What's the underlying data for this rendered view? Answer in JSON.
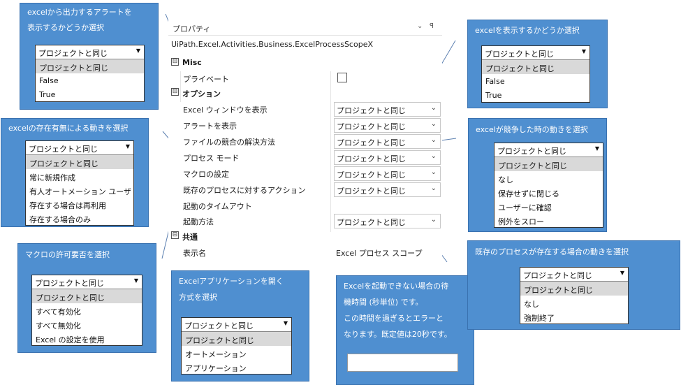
{
  "panel": {
    "title": "プロパティ",
    "controls": [
      "⌄",
      "ꟼ"
    ],
    "type_name": "UiPath.Excel.Activities.Business.ExcelProcessScopeX",
    "sections": {
      "misc": {
        "toggle": "⊟",
        "label": "Misc"
      },
      "options": {
        "toggle": "⊟",
        "label": "オプション"
      },
      "common": {
        "toggle": "⊟",
        "label": "共通"
      }
    },
    "rows": {
      "private": {
        "name": "プライベート"
      },
      "show_window": {
        "name": "Excel ウィンドウを表示",
        "value": "プロジェクトと同じ"
      },
      "show_alerts": {
        "name": "アラートを表示",
        "value": "プロジェクトと同じ"
      },
      "conflict": {
        "name": "ファイルの競合の解決方法",
        "value": "プロジェクトと同じ"
      },
      "process_mode": {
        "name": "プロセス モード",
        "value": "プロジェクトと同じ"
      },
      "macro": {
        "name": "マクロの設定",
        "value": "プロジェクトと同じ"
      },
      "existing": {
        "name": "既存のプロセスに対するアクション",
        "value": "プロジェクトと同じ"
      },
      "timeout": {
        "name": "起動のタイムアウト",
        "value": ""
      },
      "launch": {
        "name": "起動方法",
        "value": "プロジェクトと同じ"
      },
      "display_name": {
        "name": "表示名",
        "value": "Excel プロセス スコープ"
      }
    },
    "chevron": "⌄"
  },
  "callouts": {
    "alert": {
      "lines": [
        "excelから出力するアラートを",
        "表示するかどうか選択"
      ],
      "selected": "プロジェクトと同じ",
      "options": [
        "プロジェクトと同じ",
        "False",
        "True"
      ]
    },
    "exists": {
      "lines": [
        "excelの存在有無による動きを選択"
      ],
      "selected": "プロジェクトと同じ",
      "options": [
        "プロジェクトと同じ",
        "常に新規作成",
        "有人オートメーション ユーザー",
        "存在する場合は再利用",
        "存在する場合のみ"
      ]
    },
    "macro": {
      "lines": [
        "マクロの許可要否を選択"
      ],
      "selected": "プロジェクトと同じ",
      "options": [
        "プロジェクトと同じ",
        "すべて有効化",
        "すべて無効化",
        "Excel の設定を使用"
      ]
    },
    "launch": {
      "lines": [
        "Excelアプリケーションを開く",
        "方式を選択"
      ],
      "selected": "プロジェクトと同じ",
      "options": [
        "プロジェクトと同じ",
        "オートメーション",
        "アプリケーション"
      ]
    },
    "timeout": {
      "lines": [
        "Excelを起動できない場合の待",
        "機時間 (秒単位) です。",
        "この時間を過ぎるとエラーと",
        "なります。既定値は20秒です。"
      ]
    },
    "visible": {
      "lines": [
        "excelを表示するかどうか選択"
      ],
      "selected": "プロジェクトと同じ",
      "options": [
        "プロジェクトと同じ",
        "False",
        "True"
      ]
    },
    "conflict": {
      "lines": [
        "excelが競争した時の動きを選択"
      ],
      "selected": "プロジェクトと同じ",
      "options": [
        "プロジェクトと同じ",
        "なし",
        "保存せずに閉じる",
        "ユーザーに確認",
        "例外をスロー"
      ]
    },
    "existing": {
      "lines": [
        "既存のプロセスが存在する場合の動きを選択"
      ],
      "selected": "プロジェクトと同じ",
      "options": [
        "プロジェクトと同じ",
        "なし",
        "強制終了"
      ]
    }
  },
  "dropdown_arrow": "▼"
}
